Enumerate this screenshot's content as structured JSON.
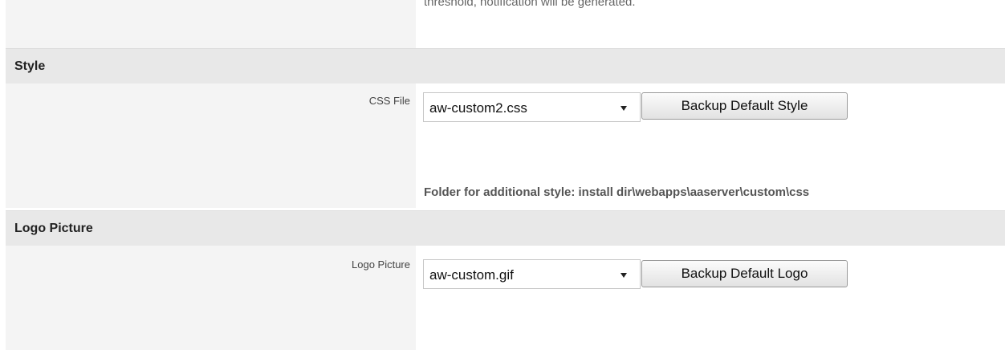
{
  "top_description": "threshold, notification will be generated.",
  "style_section": {
    "title": "Style",
    "css_label": "CSS File",
    "css_value": "aw-custom2.css",
    "backup_button": "Backup Default Style",
    "description": "Folder for additional style: install dir\\webapps\\aaserver\\custom\\css"
  },
  "logo_section": {
    "title": "Logo Picture",
    "logo_label": "Logo Picture",
    "logo_value": "aw-custom.gif",
    "backup_button": "Backup Default Logo"
  },
  "icons": {
    "dropdown": "chevron-down-icon"
  }
}
